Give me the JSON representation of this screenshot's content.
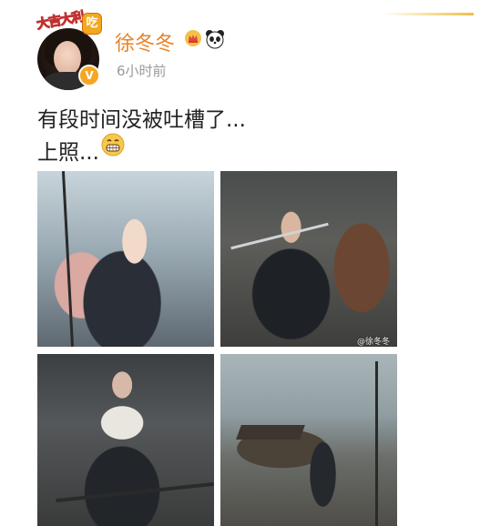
{
  "post": {
    "username": "徐冬冬",
    "timestamp": "6小时前",
    "text_line1": "有段时间没被吐槽了...",
    "text_line2": "上照...",
    "emoji_inline": "grin-emoji",
    "username_color": "#e8832a"
  },
  "avatar": {
    "sticker_text": "大吉大利",
    "sticker_chip": "吃",
    "verified_mark": "V"
  },
  "badges": [
    "crown-icon",
    "panda-icon"
  ],
  "photos": [
    {
      "name": "photo-1"
    },
    {
      "name": "photo-2",
      "watermark": "@徐冬冬"
    },
    {
      "name": "photo-3"
    },
    {
      "name": "photo-4"
    }
  ]
}
